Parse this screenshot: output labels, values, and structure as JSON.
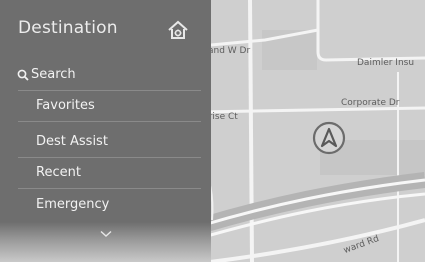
{
  "panel": {
    "title": "Destination",
    "header_icon": "home-settings-icon",
    "menu": [
      {
        "label": "Search",
        "icon": "search-icon"
      },
      {
        "label": "Favorites"
      },
      {
        "label": "Dest Assist"
      },
      {
        "label": "Recent"
      },
      {
        "label": "Emergency"
      }
    ],
    "more_icon": "chevron-down-icon"
  },
  "map": {
    "street_labels": [
      "and W Dr",
      "Daimler Insu",
      "Corporate Dr",
      "prise Ct",
      "ward Rd"
    ],
    "position_icon": "vehicle-position-icon",
    "colors": {
      "background": "#cfcfcf",
      "road": "#f2f2f2",
      "panel": "#6e6e6e"
    }
  }
}
